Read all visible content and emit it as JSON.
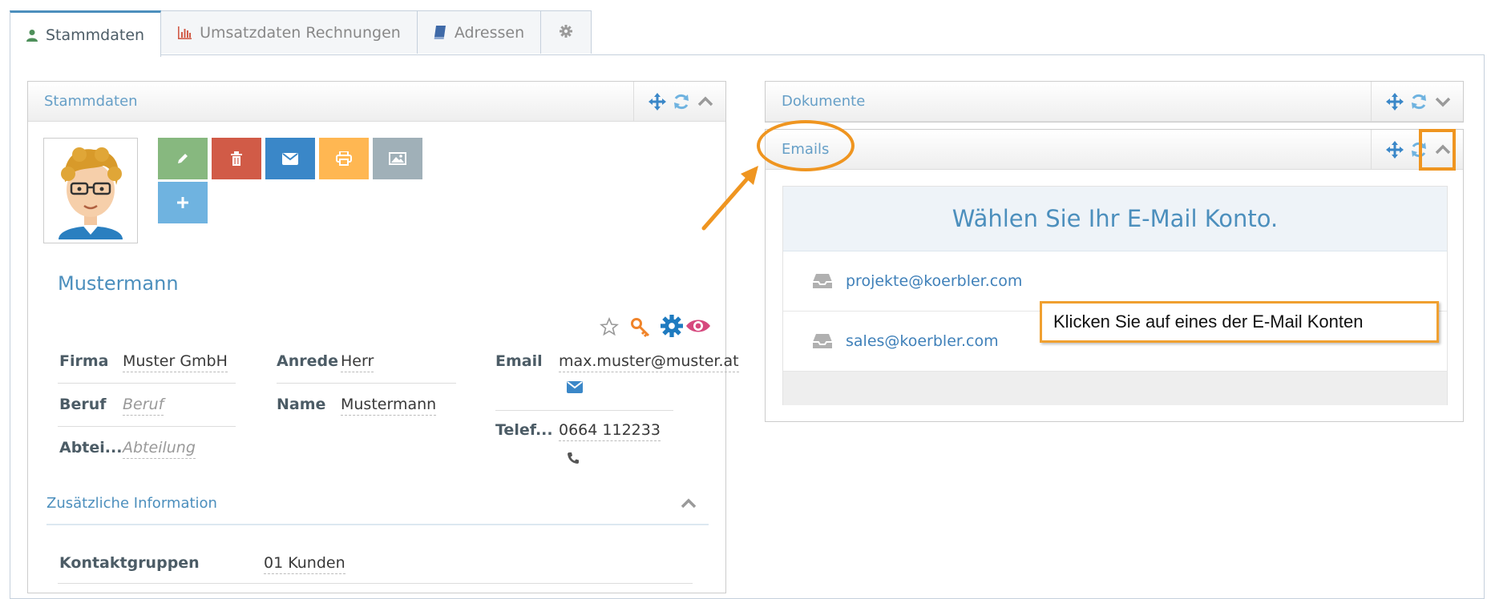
{
  "tabs": [
    {
      "label": "Stammdaten",
      "icon": "user-icon",
      "active": true
    },
    {
      "label": "Umsatzdaten Rechnungen",
      "icon": "bar-chart-icon",
      "active": false
    },
    {
      "label": "Adressen",
      "icon": "book-icon",
      "active": false
    },
    {
      "label": "",
      "icon": "gear-icon",
      "active": false
    }
  ],
  "left_widget": {
    "title": "Stammdaten",
    "name": "Mustermann",
    "fields": {
      "firma_label": "Firma",
      "firma_value": "Muster GmbH",
      "beruf_label": "Beruf",
      "beruf_placeholder": "Beruf",
      "abteilung_label": "Abtei...",
      "abteilung_placeholder": "Abteilung",
      "anrede_label": "Anrede",
      "anrede_value": "Herr",
      "name_label": "Name",
      "name_value": "Mustermann",
      "email_label": "Email",
      "email_value": "max.muster@muster.at",
      "telefon_label": "Telef...",
      "telefon_value": "0664 112233"
    },
    "section_title": "Zusätzliche Information",
    "kontaktgruppen_label": "Kontaktgruppen",
    "kontaktgruppen_value": "01 Kunden"
  },
  "dokumente_widget": {
    "title": "Dokumente"
  },
  "emails_widget": {
    "title": "Emails",
    "header": "Wählen Sie Ihr E-Mail Konto.",
    "accounts": [
      "projekte@koerbler.com",
      "sales@koerbler.com"
    ]
  },
  "callout": {
    "text": "Klicken Sie auf eines der E-Mail Konten"
  },
  "colors": {
    "accent": "#4c8fbd",
    "annotation": "#ef9520",
    "edit": "#87b87f",
    "delete": "#d15b47",
    "mail": "#3a87c8",
    "print": "#ffb752",
    "image": "#a0b0b8",
    "add": "#6fb3e0"
  }
}
